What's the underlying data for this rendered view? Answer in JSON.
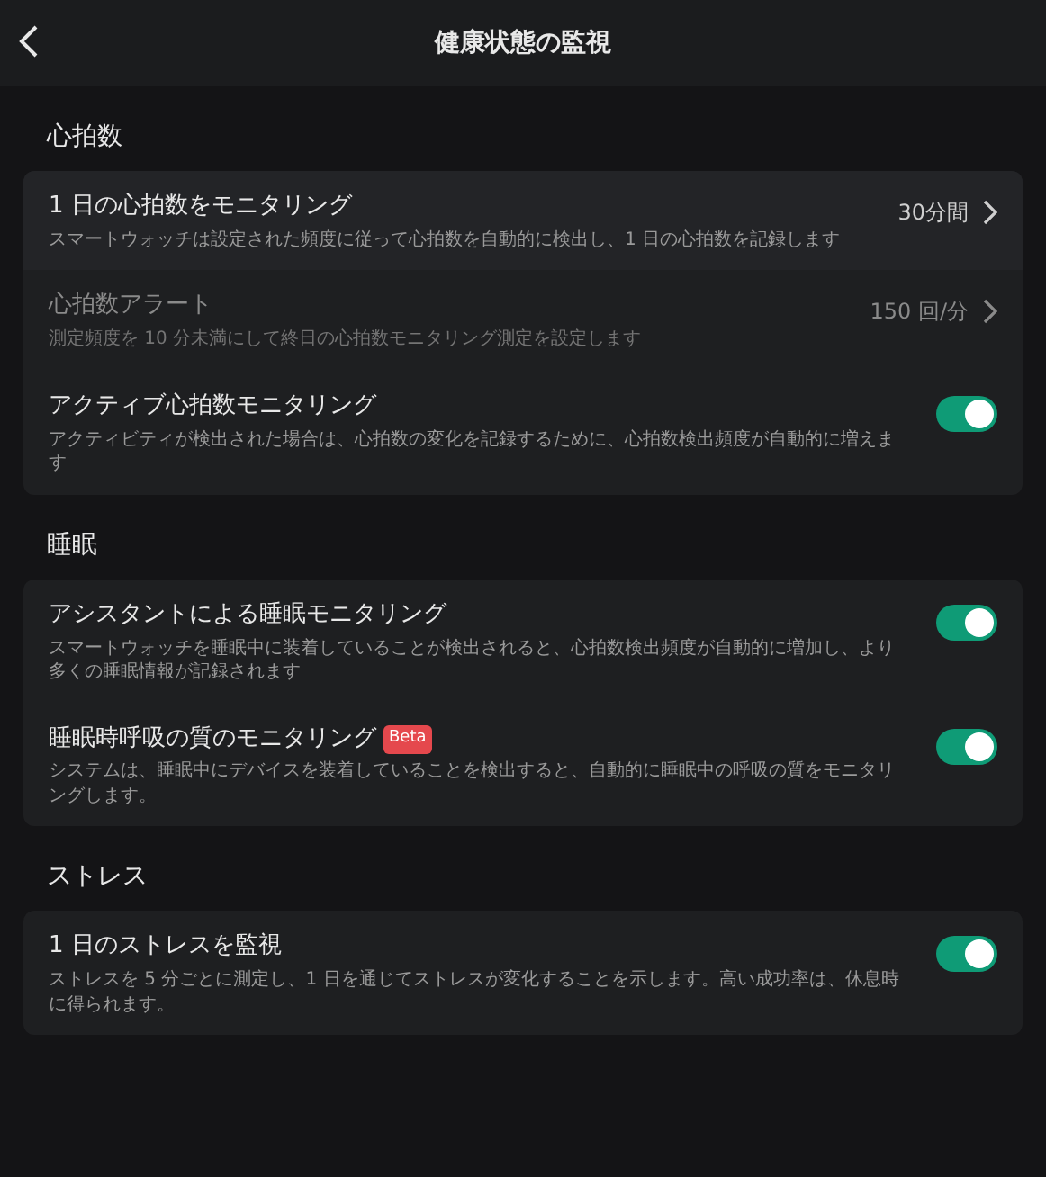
{
  "header": {
    "back_icon": true,
    "title": "健康状態の監視"
  },
  "sections": [
    {
      "title": "心拍数",
      "items": [
        {
          "kind": "link",
          "title": "1 日の心拍数をモニタリング",
          "description": "スマートウォッチは設定された頻度に従って心拍数を自動的に検出し、1 日の心拍数を記録します",
          "value": "30分間",
          "disabled": false
        },
        {
          "kind": "link",
          "title": "心拍数アラート",
          "description": "測定頻度を 10 分未満にして終日の心拍数モニタリング測定を設定します",
          "value": "150 回/分",
          "disabled": true
        },
        {
          "kind": "toggle",
          "title": "アクティブ心拍数モニタリング",
          "description": "アクティビティが検出された場合は、心拍数の変化を記録するために、心拍数検出頻度が自動的に増えます",
          "on": true,
          "disabled": false
        }
      ]
    },
    {
      "title": "睡眠",
      "items": [
        {
          "kind": "toggle",
          "title": "アシスタントによる睡眠モニタリング",
          "description": "スマートウォッチを睡眠中に装着していることが検出されると、心拍数検出頻度が自動的に増加し、より多くの睡眠情報が記録されます",
          "on": true,
          "disabled": false
        },
        {
          "kind": "toggle",
          "title": "睡眠時呼吸の質のモニタリング",
          "badge": "Beta",
          "description": "システムは、睡眠中にデバイスを装着していることを検出すると、自動的に睡眠中の呼吸の質をモニタリングします。",
          "on": true,
          "disabled": false
        }
      ]
    },
    {
      "title": "ストレス",
      "items": [
        {
          "kind": "toggle",
          "title": "1 日のストレスを監視",
          "description": "ストレスを 5 分ごとに測定し、1 日を通じてストレスが変化することを示します。高い成功率は、休息時に得られます。",
          "on": true,
          "disabled": false
        }
      ]
    }
  ]
}
